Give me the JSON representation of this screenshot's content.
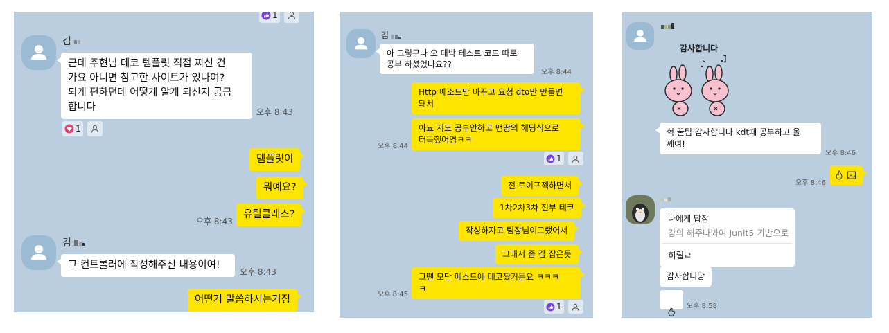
{
  "panels": [
    {
      "sender1": {
        "name": "김"
      },
      "msg1": "근데 주현님 테코 템플릿 직접 짜신 건\n가요 아니면 참고한 사이트가 있나여?\n되게 편하던데 어떻게 알게 되신지 궁금\n합니다",
      "msg1_time": "오후 8:43",
      "msg1_reaction": {
        "icon": "heart-icon",
        "count": "1"
      },
      "top_reaction_count": "1",
      "mine1": "템플릿이",
      "mine2": "뭐예요?",
      "mine3": "유틸클래스?",
      "mine_time": "오후 8:43",
      "sender2": {
        "name": "김"
      },
      "msg2": "그 컨트롤러에 작성해주신 내용이여!",
      "msg2_time": "오후 8:43",
      "mine4": "어떤거 말씀하시는거징"
    },
    {
      "sender": {
        "name": "김"
      },
      "msg1": "아 그렇구나 오 대박 테스트 코드 따로\n공부 하셨었나요??",
      "msg1_time": "오후 8:44",
      "mine1": "Http 메소드만 바꾸고 요청 dto만 만들면\n돼서",
      "mine2": "아뇨 저도 공부안하고 맨땅의 헤딩식으로\n터득했어염ㅋㅋ",
      "mine2_time": "오후 8:44",
      "reaction1_count": "1",
      "mine3": "전 토이프젝하면서",
      "mine4": "1차2차3차 전부 테코",
      "mine5": "작성하자고 팀장님이그랬어서",
      "mine6": "그래서 좀 감 잡은듯",
      "mine7": "그땐 모단 메소드에 테코짰거든요 ㅋㅋㅋ\nㅋ",
      "mine7_time": "오후 8:45",
      "reaction2_count": "1"
    },
    {
      "sticker_text": "감사합니다",
      "msg1": "헉 꿀팁 감사합니다 kdt때 공부하고 올\n께여!",
      "msg1_time": "오후 8:46",
      "mine1_time": "오후 8:46",
      "mine1_icons": [
        "fire-icon",
        "image-icon"
      ],
      "reply_title": "나에게 답장",
      "reply_quote": "강의 해주나봐여 Junit5 기반으로",
      "reply_body": "히릴ㄹ",
      "msg2": "감사합니당",
      "emoji_time": "오후 8:58",
      "emoji_icon": "hand-emoji-icon"
    }
  ],
  "colors": {
    "chat_bg": "#bacee0",
    "my_bubble": "#fee500",
    "their_bubble": "#ffffff",
    "heart": "#e83e6c",
    "like": "#7b3fe4"
  }
}
